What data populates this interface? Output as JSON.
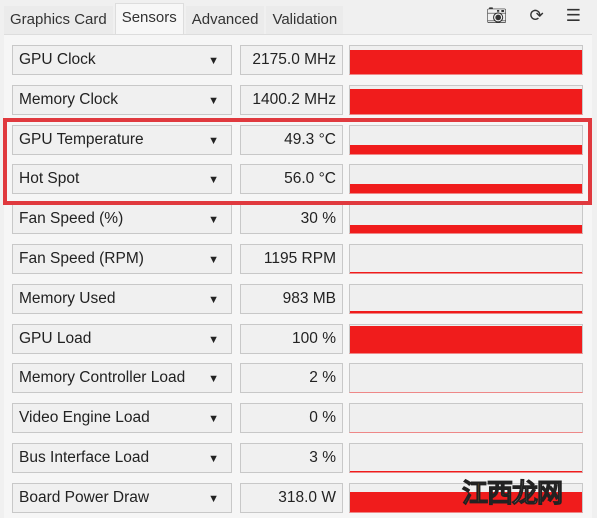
{
  "tabs": [
    "Graphics Card",
    "Sensors",
    "Advanced",
    "Validation"
  ],
  "active_tab": "Sensors",
  "toolbar": {
    "camera": "camera-icon",
    "refresh": "refresh-icon",
    "menu": "menu-icon"
  },
  "graph_color": "#f01c1c",
  "highlight_color": "#e0393e",
  "sensors": [
    {
      "name": "GPU Clock",
      "value": "2175.0 MHz",
      "level": 0.85
    },
    {
      "name": "Memory Clock",
      "value": "1400.2 MHz",
      "level": 0.88
    },
    {
      "name": "GPU Temperature",
      "value": "49.3 °C",
      "level": 0.3
    },
    {
      "name": "Hot Spot",
      "value": "56.0 °C",
      "level": 0.35
    },
    {
      "name": "Fan Speed (%)",
      "value": "30 %",
      "level": 0.3
    },
    {
      "name": "Fan Speed (RPM)",
      "value": "1195 RPM",
      "level": 0.03
    },
    {
      "name": "Memory Used",
      "value": "983 MB",
      "level": 0.05
    },
    {
      "name": "GPU Load",
      "value": "100 %",
      "level": 0.95
    },
    {
      "name": "Memory Controller Load",
      "value": "2 %",
      "level": 0.02
    },
    {
      "name": "Video Engine Load",
      "value": "0 %",
      "level": 0
    },
    {
      "name": "Bus Interface Load",
      "value": "3 %",
      "level": 0.03
    },
    {
      "name": "Board Power Draw",
      "value": "318.0 W",
      "level": 0.7
    }
  ],
  "watermark": {
    "part1": "江西",
    "part2": "龙网"
  }
}
